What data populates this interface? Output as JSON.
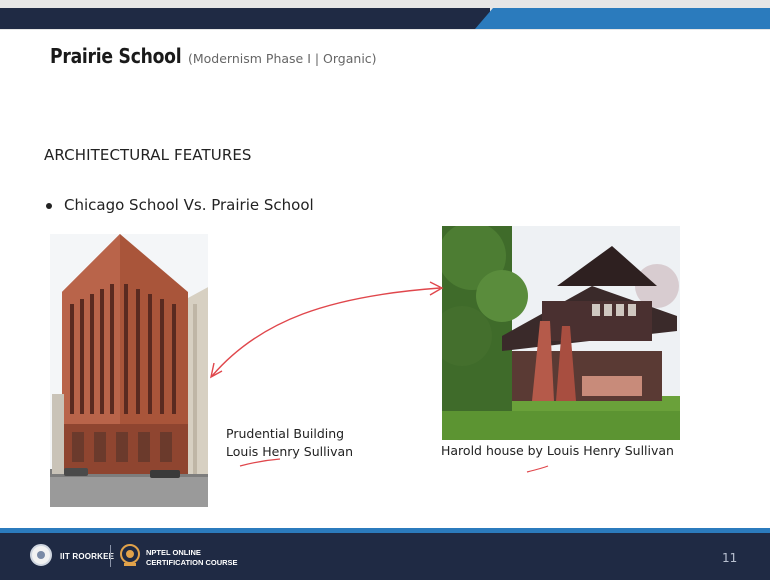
{
  "slide": {
    "title": "Prairie School",
    "subtitle": "(Modernism Phase I | Organic)",
    "heading": "ARCHITECTURAL FEATURES",
    "bullet": "Chicago School Vs. Prairie School",
    "page_number": "11"
  },
  "images": [
    {
      "caption_line1": "Prudential Building",
      "caption_line2": "Louis Henry Sullivan"
    },
    {
      "caption": "Harold house by Louis Henry Sullivan"
    }
  ],
  "footer": {
    "institute": "IIT ROORKEE",
    "course_line1": "NPTEL ONLINE",
    "course_line2": "CERTIFICATION COURSE"
  },
  "colors": {
    "header_dark": "#1f2a44",
    "accent_blue": "#2b7bbd",
    "annotation_red": "#e0474c"
  }
}
